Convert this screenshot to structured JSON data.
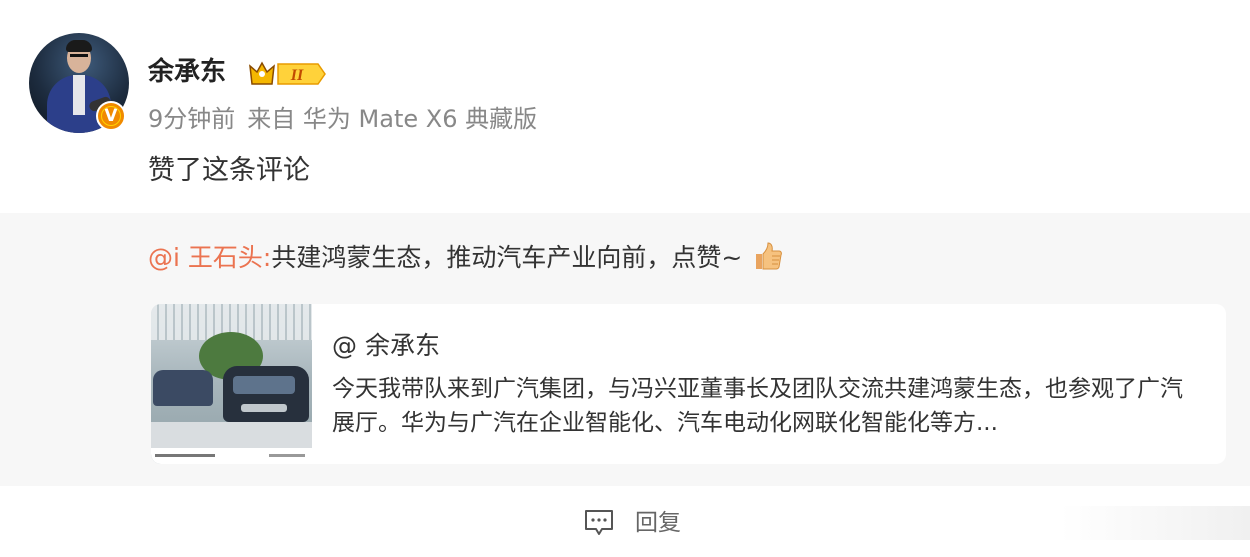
{
  "post": {
    "username": "余承东",
    "vip_level": "II",
    "time": "9分钟前",
    "source": "来自 华为 Mate X6 典藏版",
    "action_text": "赞了这条评论"
  },
  "comment": {
    "mention": "@i 王石头:",
    "text": "共建鸿蒙生态，推动汽车产业向前，点赞~"
  },
  "card": {
    "author": "@ 余承东",
    "text": "今天我带队来到广汽集团，与冯兴亚董事长及团队交流共建鸿蒙生态，也参观了广汽展厅。华为与广汽在企业智能化、汽车电动化网联化智能化等方..."
  },
  "footer": {
    "reply_label": "回复"
  },
  "colors": {
    "mention": "#eb7350",
    "badge_orange": "#f08a00",
    "vip_gold": "#f5b700"
  }
}
